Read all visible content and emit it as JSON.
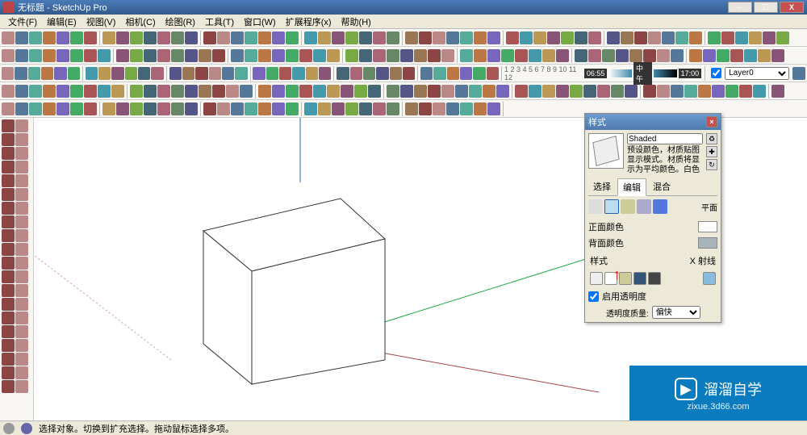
{
  "title": "无标题 - SketchUp Pro",
  "window_controls": {
    "minimize": "–",
    "maximize": "☐",
    "close": "X"
  },
  "menu": {
    "items": [
      "文件(F)",
      "编辑(E)",
      "视图(V)",
      "相机(C)",
      "绘图(R)",
      "工具(T)",
      "窗口(W)",
      "扩展程序(x)",
      "帮助(H)"
    ]
  },
  "layer": {
    "label": "Layer0",
    "checked": true
  },
  "time_badges": [
    "06:55",
    "中午",
    "17:00"
  ],
  "styles_panel": {
    "title": "样式",
    "name_field": "Shaded",
    "description": "预设颜色，材质贴图显示模式。材质将显示为平均颜色。白色",
    "tabs": [
      "选择",
      "编辑",
      "混合"
    ],
    "active_tab": 1,
    "plane_label": "平面",
    "front_color_label": "正面颜色",
    "back_color_label": "背面颜色",
    "front_color": "#ffffff",
    "back_color": "#a8b4bc",
    "style_label": "样式",
    "xray_label": "X 射线",
    "enable_opacity_label": "启用透明度",
    "enable_opacity_checked": true,
    "opacity_quality_label": "透明度质量:",
    "opacity_quality_value": "偏快"
  },
  "statusbar": {
    "text": "选择对象。切换到扩充选择。拖动鼠标选择多项。"
  },
  "watermark": {
    "text": "溜溜自学",
    "url": "zixue.3d66.com"
  }
}
